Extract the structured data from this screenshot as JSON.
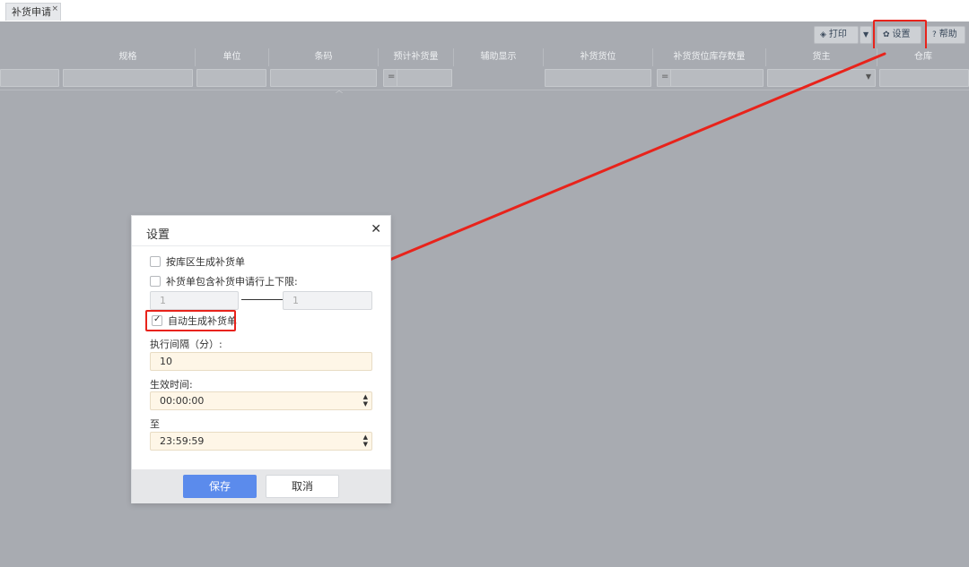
{
  "tab": {
    "label": "补货申请",
    "close_icon": "×"
  },
  "toolbar": {
    "print_label": "打印",
    "settings_label": "设置",
    "help_label": "帮助"
  },
  "grid": {
    "columns": [
      "规格",
      "单位",
      "条码",
      "预计补货量",
      "辅助显示",
      "补货货位",
      "补货货位库存数量",
      "货主",
      "仓库"
    ],
    "eq_symbol": "="
  },
  "dialog": {
    "title": "设置",
    "checkbox_by_area": {
      "label": "按库区生成补货单",
      "checked": false
    },
    "checkbox_limits": {
      "label": "补货单包含补货申请行上下限:",
      "checked": false
    },
    "limit_min": "1",
    "limit_max": "1",
    "checkbox_auto": {
      "label": "自动生成补货单",
      "checked": true
    },
    "interval_label": "执行间隔（分）:",
    "interval_value": "10",
    "effective_label": "生效时间:",
    "effective_value": "00:00:00",
    "to_label": "至",
    "to_value": "23:59:59",
    "save_label": "保存",
    "cancel_label": "取消"
  },
  "colors": {
    "highlight": "#e8231b",
    "primary_button": "#5b8bec",
    "overlay": "#a8abb1"
  }
}
